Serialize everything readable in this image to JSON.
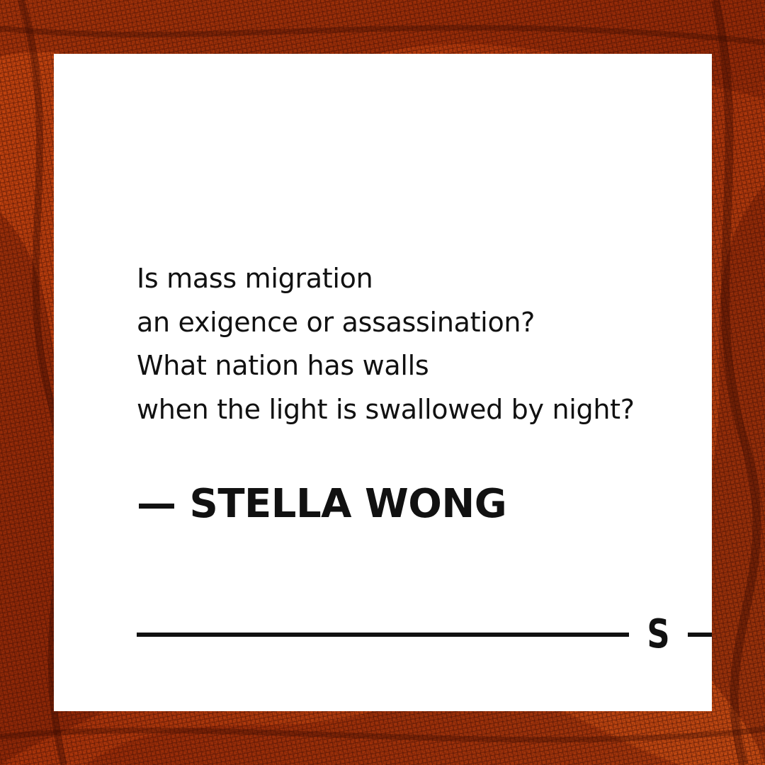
{
  "background": {
    "description_colors": {
      "base": "#b33a0c",
      "dark": "#5a1404",
      "highlight": "#e0581c"
    }
  },
  "quote": {
    "lines": [
      "Is mass migration",
      "an exigence or assassination?",
      "What nation has walls",
      "when the light is swallowed by night?"
    ]
  },
  "author": "— STELLA WONG",
  "logo": {
    "letter": "S"
  }
}
